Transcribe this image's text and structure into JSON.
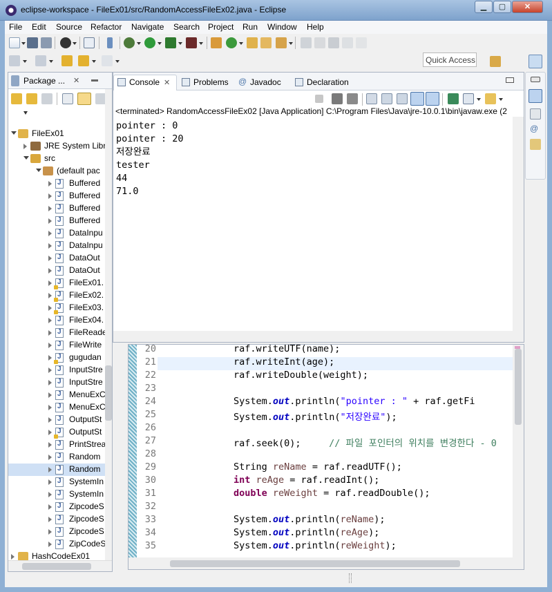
{
  "window": {
    "title": "eclipse-workspace - FileEx01/src/RandomAccessFileEx02.java - Eclipse"
  },
  "menu": [
    "File",
    "Edit",
    "Source",
    "Refactor",
    "Navigate",
    "Search",
    "Project",
    "Run",
    "Window",
    "Help"
  ],
  "toolbar": {
    "quick_access": "Quick Access"
  },
  "package_explorer": {
    "tab_label": "Package ...",
    "close_glyph": "✕",
    "tree": [
      {
        "label": "FileEx01",
        "kind": "project",
        "expanded": true,
        "level": 0
      },
      {
        "label": "JRE System Libr",
        "kind": "library",
        "expanded": false,
        "level": 1
      },
      {
        "label": "src",
        "kind": "folder",
        "expanded": true,
        "level": 1
      },
      {
        "label": "(default pac",
        "kind": "package",
        "expanded": true,
        "level": 2
      },
      {
        "label": "Buffered",
        "kind": "file",
        "level": 3
      },
      {
        "label": "Buffered",
        "kind": "file",
        "level": 3
      },
      {
        "label": "Buffered",
        "kind": "file",
        "level": 3
      },
      {
        "label": "Buffered",
        "kind": "file",
        "level": 3
      },
      {
        "label": "DataInpu",
        "kind": "file",
        "level": 3
      },
      {
        "label": "DataInpu",
        "kind": "file",
        "level": 3
      },
      {
        "label": "DataOut",
        "kind": "file",
        "level": 3
      },
      {
        "label": "DataOut",
        "kind": "file",
        "level": 3
      },
      {
        "label": "FileEx01.",
        "kind": "file-warn",
        "level": 3
      },
      {
        "label": "FileEx02.",
        "kind": "file-warn",
        "level": 3
      },
      {
        "label": "FileEx03.",
        "kind": "file-warn",
        "level": 3
      },
      {
        "label": "FileEx04.",
        "kind": "file",
        "level": 3
      },
      {
        "label": "FileReade",
        "kind": "file",
        "level": 3
      },
      {
        "label": "FileWrite",
        "kind": "file",
        "level": 3
      },
      {
        "label": "gugudan",
        "kind": "file-warn",
        "level": 3
      },
      {
        "label": "InputStre",
        "kind": "file",
        "level": 3
      },
      {
        "label": "InputStre",
        "kind": "file",
        "level": 3
      },
      {
        "label": "MenuExC",
        "kind": "file",
        "level": 3
      },
      {
        "label": "MenuExC",
        "kind": "file",
        "level": 3
      },
      {
        "label": "OutputSt",
        "kind": "file",
        "level": 3
      },
      {
        "label": "OutputSt",
        "kind": "file-warn",
        "level": 3
      },
      {
        "label": "PrintStrea",
        "kind": "file",
        "level": 3
      },
      {
        "label": "Random",
        "kind": "file",
        "level": 3
      },
      {
        "label": "Random",
        "kind": "file",
        "level": 3,
        "selected": true
      },
      {
        "label": "SystemIn",
        "kind": "file",
        "level": 3
      },
      {
        "label": "SystemIn",
        "kind": "file",
        "level": 3
      },
      {
        "label": "ZipcodeS",
        "kind": "file",
        "level": 3
      },
      {
        "label": "ZipcodeS",
        "kind": "file",
        "level": 3
      },
      {
        "label": "ZipcodeS",
        "kind": "file",
        "level": 3
      },
      {
        "label": "ZipCodeS",
        "kind": "file",
        "level": 3
      },
      {
        "label": "HashCodeEx01",
        "kind": "project",
        "expanded": false,
        "level": 0
      }
    ]
  },
  "console": {
    "tabs": [
      {
        "label": "Console",
        "active": true
      },
      {
        "label": "Problems"
      },
      {
        "label": "Javadoc"
      },
      {
        "label": "Declaration"
      }
    ],
    "close_glyph": "✕",
    "status": "<terminated> RandomAccessFileEx02 [Java Application] C:\\Program Files\\Java\\jre-10.0.1\\bin\\javaw.exe (2",
    "output": [
      "pointer : 0",
      "pointer : 20",
      "저장완료",
      "tester",
      "44",
      "71.0"
    ]
  },
  "editor": {
    "lines": [
      {
        "n": "20",
        "t": [
          [
            "",
            "raf.writeUTF(name);"
          ]
        ]
      },
      {
        "n": "21",
        "t": [
          [
            "",
            "raf.writeInt(age);"
          ]
        ],
        "current": true
      },
      {
        "n": "22",
        "t": [
          [
            "",
            "raf.writeDouble(weight);"
          ]
        ]
      },
      {
        "n": "23",
        "t": []
      },
      {
        "n": "24",
        "t": [
          [
            "",
            "System."
          ],
          [
            "fld",
            "out"
          ],
          [
            "",
            ".println("
          ],
          [
            "str",
            "\"pointer : \""
          ],
          [
            "",
            " + raf.getFi"
          ]
        ]
      },
      {
        "n": "25",
        "t": [
          [
            "",
            "System."
          ],
          [
            "fld",
            "out"
          ],
          [
            "",
            ".println("
          ],
          [
            "str",
            "\"저장완료\""
          ],
          [
            "",
            ");"
          ]
        ]
      },
      {
        "n": "26",
        "t": []
      },
      {
        "n": "27",
        "t": [
          [
            "",
            "raf.seek(0);     "
          ],
          [
            "cm",
            "// 파일 포인터의 위치를 변경한다 - 0"
          ]
        ]
      },
      {
        "n": "28",
        "t": []
      },
      {
        "n": "29",
        "t": [
          [
            "",
            "String "
          ],
          [
            "var",
            "reName"
          ],
          [
            "",
            " = raf.readUTF();"
          ]
        ]
      },
      {
        "n": "30",
        "t": [
          [
            "kw",
            "int"
          ],
          [
            "",
            " "
          ],
          [
            "var",
            "reAge"
          ],
          [
            "",
            " = raf.readInt();"
          ]
        ]
      },
      {
        "n": "31",
        "t": [
          [
            "kw",
            "double"
          ],
          [
            "",
            " "
          ],
          [
            "var",
            "reWeight"
          ],
          [
            "",
            " = raf.readDouble();"
          ]
        ]
      },
      {
        "n": "32",
        "t": []
      },
      {
        "n": "33",
        "t": [
          [
            "",
            "System."
          ],
          [
            "fld",
            "out"
          ],
          [
            "",
            ".println("
          ],
          [
            "var",
            "reName"
          ],
          [
            "",
            ");"
          ]
        ]
      },
      {
        "n": "34",
        "t": [
          [
            "",
            "System."
          ],
          [
            "fld",
            "out"
          ],
          [
            "",
            ".println("
          ],
          [
            "var",
            "reAge"
          ],
          [
            "",
            ");"
          ]
        ]
      },
      {
        "n": "35",
        "t": [
          [
            "",
            "System."
          ],
          [
            "fld",
            "out"
          ],
          [
            "",
            ".println("
          ],
          [
            "var",
            "reWeight"
          ],
          [
            "",
            ");"
          ]
        ]
      }
    ]
  },
  "colors": {
    "accent": "#3b6ea5",
    "selection": "#cfe0f5",
    "current_line": "#e8f2fe",
    "keyword": "#7f0055",
    "string": "#2a00ff",
    "comment": "#3f7f5f"
  }
}
